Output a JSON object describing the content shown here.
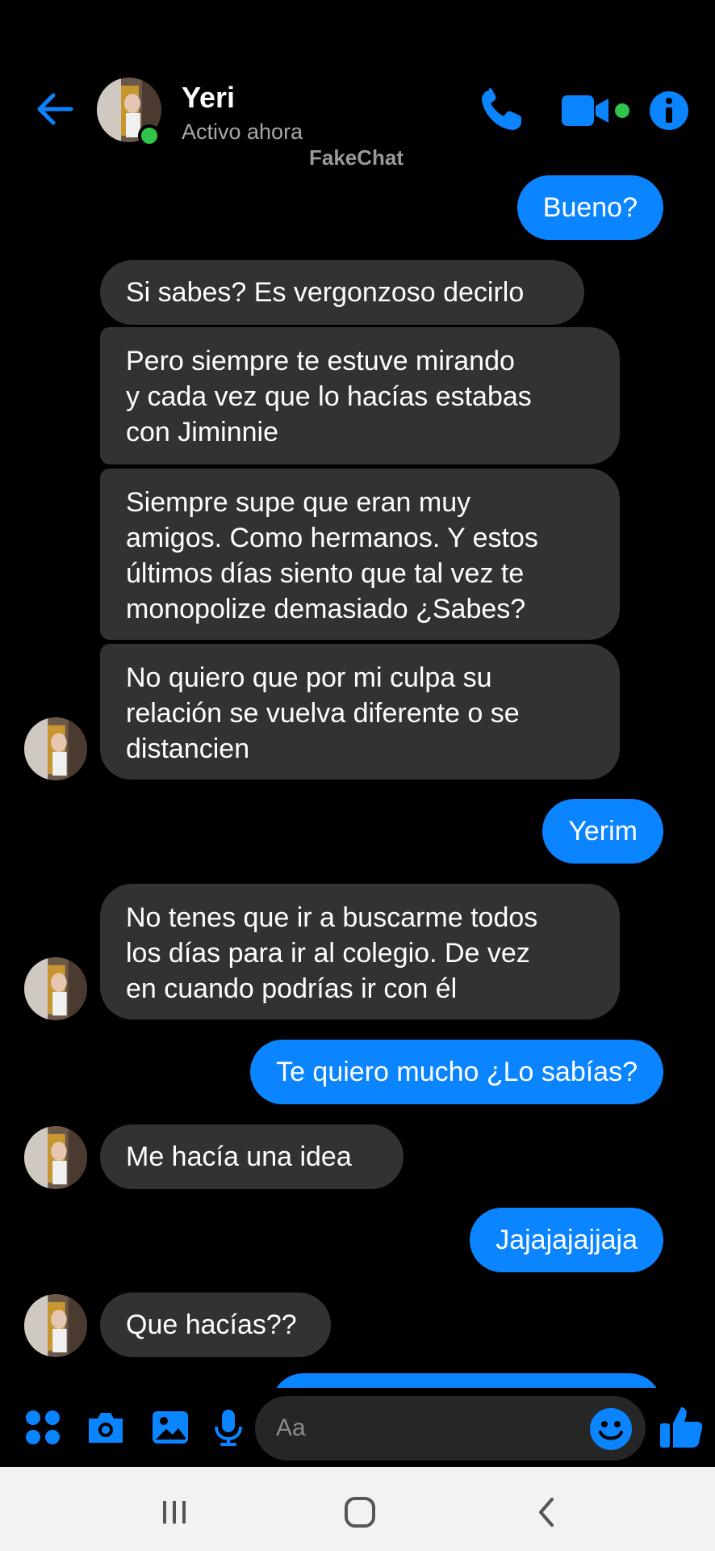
{
  "header": {
    "contact_name": "Yeri",
    "status": "Activo ahora",
    "watermark": "FakeChat",
    "icons": [
      "back-arrow-icon",
      "phone-icon",
      "video-camera-icon",
      "info-icon"
    ]
  },
  "messages": [
    {
      "from": "me",
      "text": "Bueno?"
    },
    {
      "from": "them",
      "lines": [
        "Si sabes? Es vergonzoso decirlo"
      ]
    },
    {
      "from": "them",
      "lines": [
        "Pero siempre te estuve mirando",
        "y cada vez que lo hacías estabas",
        "con Jiminnie"
      ]
    },
    {
      "from": "them",
      "lines": [
        "Siempre supe que eran muy",
        "amigos. Como hermanos. Y estos",
        "últimos días siento que tal vez te",
        "monopolize demasiado ¿Sabes?"
      ]
    },
    {
      "from": "them",
      "lines": [
        "No quiero que por mi culpa su",
        "relación se vuelva diferente o se",
        "distancien"
      ]
    },
    {
      "from": "me",
      "text": "Yerim"
    },
    {
      "from": "them",
      "lines": [
        "No tenes que ir a buscarme todos",
        "los días para ir al colegio. De vez",
        "en cuando podrías ir con él"
      ]
    },
    {
      "from": "me",
      "text": "Te quiero mucho ¿Lo sabías?"
    },
    {
      "from": "them",
      "lines": [
        "Me hacía una idea"
      ]
    },
    {
      "from": "me",
      "text": "Jajajajajjaja"
    },
    {
      "from": "them",
      "lines": [
        "Que hacías??"
      ]
    }
  ],
  "composer": {
    "placeholder": "Aa",
    "tools": [
      "apps-icon",
      "camera-icon",
      "gallery-icon",
      "microphone-icon",
      "emoji-icon",
      "like-icon"
    ]
  },
  "colors": {
    "accent": "#0a84ff",
    "incoming_bubble": "#323232",
    "online": "#31c34a",
    "background": "#000000"
  }
}
